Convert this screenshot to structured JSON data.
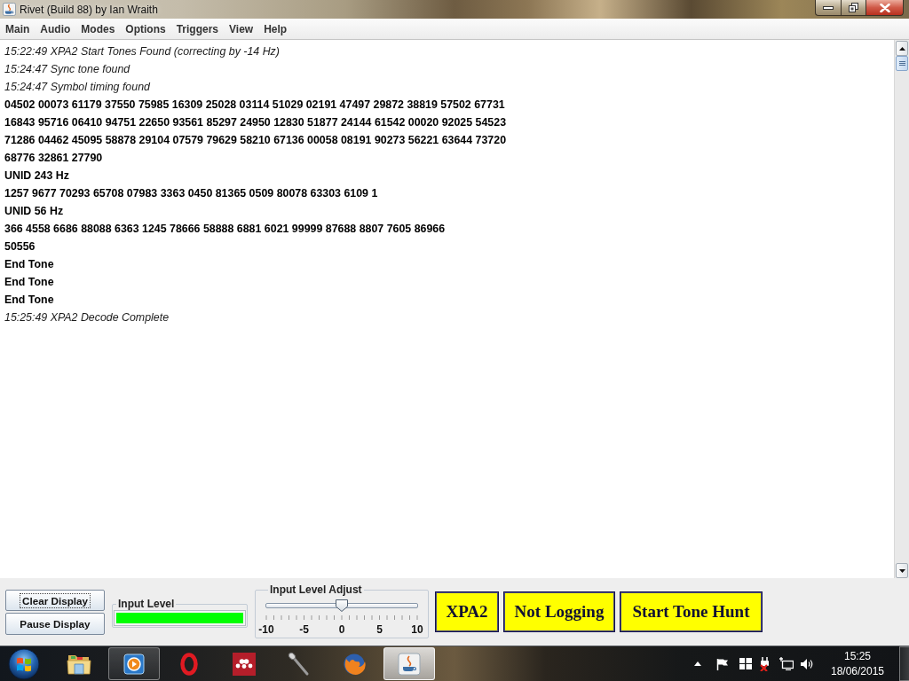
{
  "window": {
    "title": "Rivet (Build 88) by Ian Wraith"
  },
  "menu": [
    "Main",
    "Audio",
    "Modes",
    "Options",
    "Triggers",
    "View",
    "Help"
  ],
  "log": [
    {
      "kind": "event",
      "text": "15:22:49 XPA2 Start Tones Found (correcting by -14 Hz)"
    },
    {
      "kind": "event",
      "text": "15:24:47 Sync tone found"
    },
    {
      "kind": "event",
      "text": "15:24:47 Symbol timing found"
    },
    {
      "kind": "data",
      "text": "04502 00073 61179 37550 75985 16309 25028 03114 51029 02191 47497 29872 38819 57502 67731"
    },
    {
      "kind": "data",
      "text": "16843 95716 06410 94751 22650 93561 85297 24950 12830 51877 24144 61542 00020 92025 54523"
    },
    {
      "kind": "data",
      "text": "71286 04462 45095 58878 29104 07579 79629 58210 67136 00058 08191 90273 56221 63644 73720"
    },
    {
      "kind": "data",
      "text": "68776 32861 27790"
    },
    {
      "kind": "data",
      "text": "UNID 243 Hz"
    },
    {
      "kind": "data",
      "text": "1257 9677 70293 65708 07983 3363 0450 81365 0509 80078 63303 6109 1"
    },
    {
      "kind": "data",
      "text": "UNID 56 Hz"
    },
    {
      "kind": "data",
      "text": "366 4558 6686 88088 6363 1245 78666 58888 6881 6021 99999 87688 8807 7605 86966"
    },
    {
      "kind": "data",
      "text": "50556"
    },
    {
      "kind": "data",
      "text": "End Tone"
    },
    {
      "kind": "data",
      "text": "End Tone"
    },
    {
      "kind": "data",
      "text": "End Tone"
    },
    {
      "kind": "event",
      "text": "15:25:49 XPA2 Decode Complete"
    }
  ],
  "controls": {
    "buttons": [
      {
        "label": "Clear Display",
        "focused": true
      },
      {
        "label": "Pause Display",
        "focused": false
      }
    ],
    "input_level": {
      "title": "Input Level",
      "level": 1
    },
    "level_adjust": {
      "title": "Input Level Adjust",
      "level": 0.5,
      "tick_labels": [
        "-10",
        "-5",
        "0",
        "5",
        "10"
      ]
    },
    "status_buttons": [
      "XPA2",
      "Not Logging",
      "Start Tone Hunt"
    ]
  },
  "taskbar": {
    "apps": [
      {
        "kind": "folder",
        "running": false,
        "active": false
      },
      {
        "kind": "player",
        "running": true,
        "active": false
      },
      {
        "kind": "ring",
        "running": false,
        "active": false
      },
      {
        "kind": "dots",
        "running": false,
        "active": false
      },
      {
        "kind": "microphone",
        "running": false,
        "active": false
      },
      {
        "kind": "globe",
        "running": false,
        "active": false
      },
      {
        "kind": "cup",
        "running": true,
        "active": true
      }
    ],
    "clock": {
      "time": "15:25",
      "date": "18/06/2015"
    }
  }
}
